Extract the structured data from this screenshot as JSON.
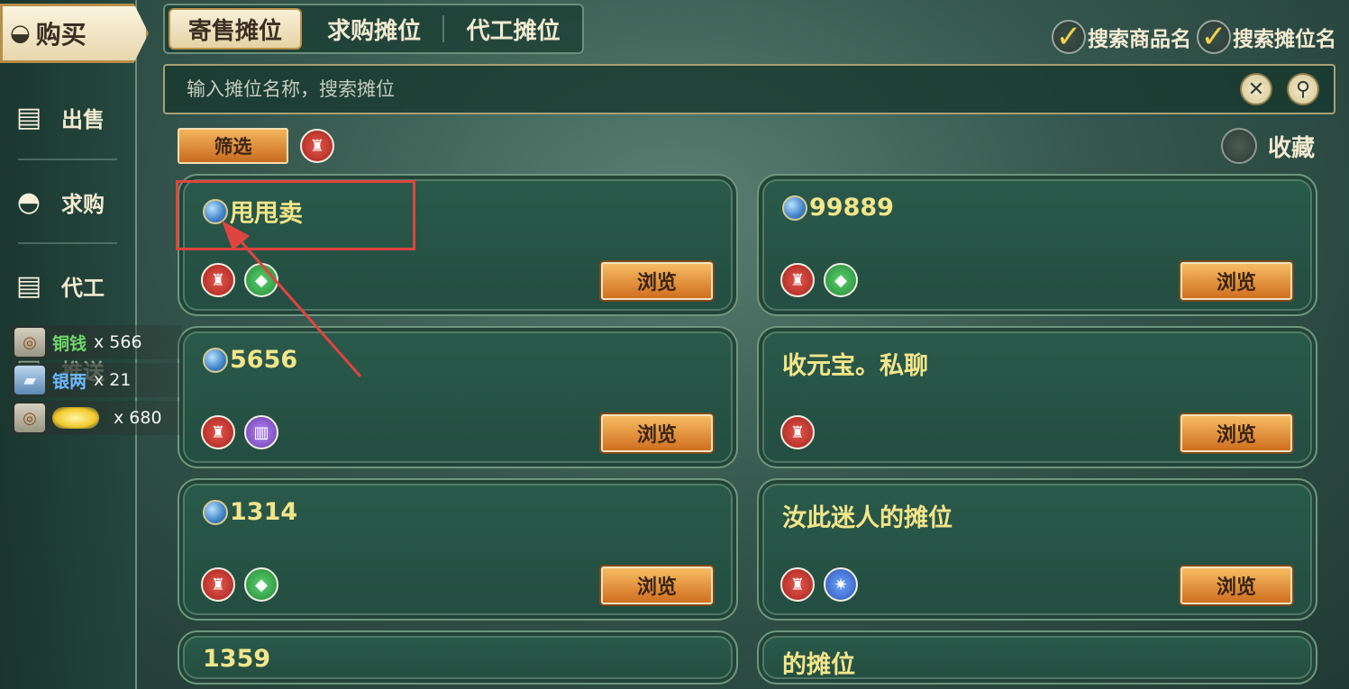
{
  "sidebar": {
    "buy_label": "购买",
    "items": [
      {
        "label": "出售",
        "icon": "stall-icon"
      },
      {
        "label": "求购",
        "icon": "ingot-bowl-icon"
      },
      {
        "label": "代工",
        "icon": "stall-icon"
      },
      {
        "label": "推送",
        "icon": "stall-icon"
      }
    ]
  },
  "currency": [
    {
      "name": "铜钱",
      "count": "x 566",
      "color": "#6fd86b",
      "icon": "copper-coin-icon"
    },
    {
      "name": "银两",
      "count": "x 21",
      "color": "#6cb9ff",
      "icon": "silver-ingot-icon"
    },
    {
      "name": "",
      "count": "x 680",
      "color": "#f4d24a",
      "icon": "gold-coin-icon"
    }
  ],
  "tabs": [
    "寄售摊位",
    "求购摊位",
    "代工摊位"
  ],
  "options": {
    "search_item_name": "搜索商品名",
    "search_stall_name": "搜索摊位名"
  },
  "search": {
    "placeholder": "输入摊位名称，搜索摊位"
  },
  "filter": {
    "label": "筛选",
    "favorite_label": "收藏"
  },
  "stalls": [
    {
      "name": "甩甩卖",
      "globe": true,
      "tags": [
        "red",
        "green"
      ],
      "browse": "浏览"
    },
    {
      "name": "99889",
      "globe": true,
      "tags": [
        "red",
        "green"
      ],
      "browse": "浏览"
    },
    {
      "name": "5656",
      "globe": true,
      "tags": [
        "red",
        "purple"
      ],
      "browse": "浏览"
    },
    {
      "name": "收元宝。私聊",
      "globe": false,
      "tags": [
        "red"
      ],
      "browse": "浏览"
    },
    {
      "name": "1314",
      "globe": true,
      "tags": [
        "red",
        "green"
      ],
      "browse": "浏览"
    },
    {
      "name": "汝此迷人的摊位",
      "globe": false,
      "tags": [
        "red",
        "blue"
      ],
      "browse": "浏览"
    },
    {
      "name": "1359",
      "globe": false,
      "tags": [],
      "browse": ""
    },
    {
      "name": "的摊位",
      "globe": false,
      "tags": [],
      "browse": ""
    }
  ]
}
